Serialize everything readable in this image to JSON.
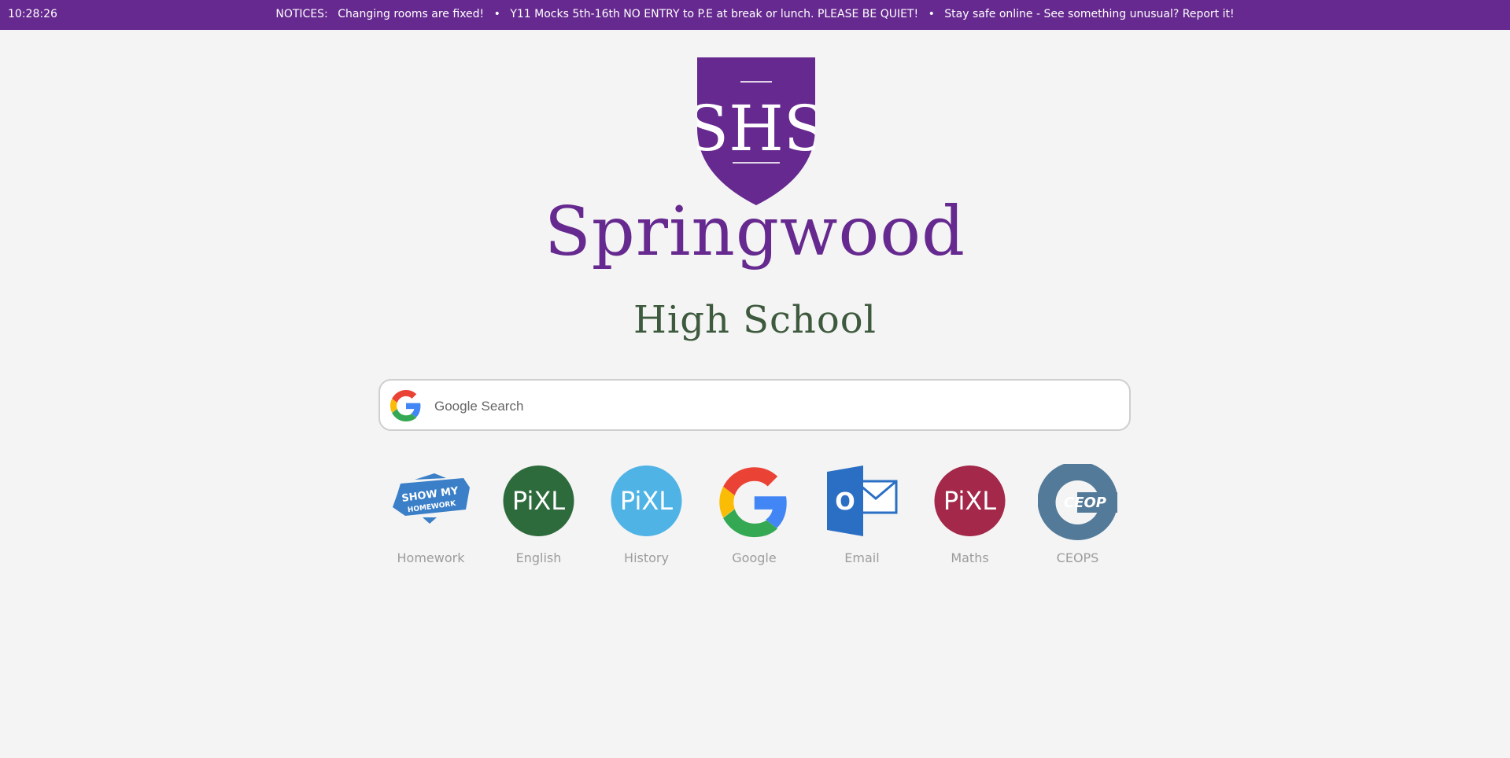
{
  "topbar": {
    "clock": "10:28:26",
    "notices_label": "NOTICES:",
    "notices": [
      "Changing rooms are fixed!",
      "Y11 Mocks 5th-16th NO ENTRY to P.E at break or lunch. PLEASE BE QUIET!",
      "Stay safe online - See something unusual? Report it!"
    ],
    "separator": "•",
    "background_color": "#66298f"
  },
  "school": {
    "crest_text": "SHS",
    "name": "Springwood",
    "subtitle": "High School",
    "primary_color": "#66298f",
    "secondary_color": "#3e5a3e"
  },
  "search": {
    "icon": "google-g-icon",
    "placeholder": "Google Search",
    "value": ""
  },
  "shortcuts": [
    {
      "label": "Homework",
      "icon": "show-my-homework-icon",
      "badge_text": "SHOW MY",
      "badge_sub": "HOMEWORK"
    },
    {
      "label": "English",
      "icon": "pixl-english-icon",
      "badge_text": "PiXL",
      "color": "#2e6b3c"
    },
    {
      "label": "History",
      "icon": "pixl-history-icon",
      "badge_text": "PiXL",
      "color": "#4fb3e6"
    },
    {
      "label": "Google",
      "icon": "google-g-icon"
    },
    {
      "label": "Email",
      "icon": "outlook-icon",
      "badge_text": "O"
    },
    {
      "label": "Maths",
      "icon": "pixl-maths-icon",
      "badge_text": "PiXL",
      "color": "#a3284a"
    },
    {
      "label": "CEOPS",
      "icon": "ceop-icon",
      "badge_text": "CEOP",
      "color": "#537a98"
    }
  ]
}
